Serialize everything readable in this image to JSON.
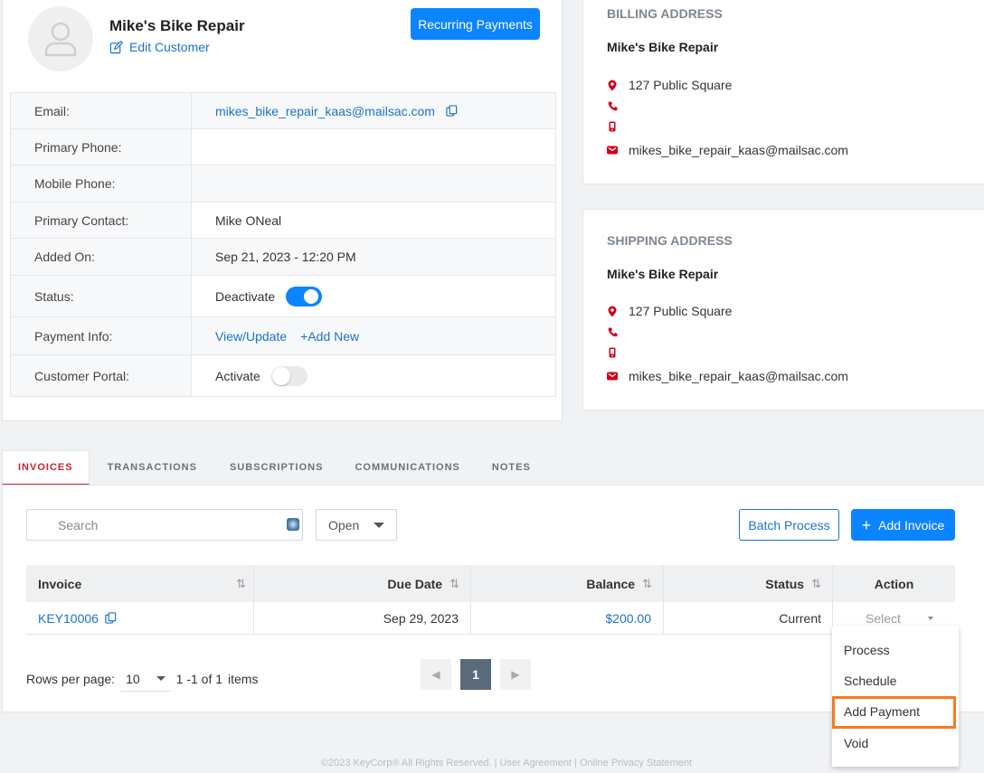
{
  "customer": {
    "name": "Mike's Bike Repair",
    "edit_label": "Edit Customer",
    "recurring_label": "Recurring Payments",
    "fields": {
      "email_label": "Email:",
      "email_value": "mikes_bike_repair_kaas@mailsac.com",
      "primary_phone_label": "Primary Phone:",
      "primary_phone_value": "",
      "mobile_phone_label": "Mobile Phone:",
      "mobile_phone_value": "",
      "primary_contact_label": "Primary Contact:",
      "primary_contact_value": "Mike ONeal",
      "added_on_label": "Added On:",
      "added_on_value": "Sep 21, 2023 - 12:20 PM",
      "status_label": "Status:",
      "status_action": "Deactivate",
      "status_on": true,
      "payment_info_label": "Payment Info:",
      "view_update": "View/Update",
      "add_new": "+Add New",
      "portal_label": "Customer Portal:",
      "portal_action": "Activate",
      "portal_on": false
    }
  },
  "billing": {
    "title": "BILLING ADDRESS",
    "name": "Mike's Bike Repair",
    "street": "127 Public Square",
    "phone": "",
    "mobile": "",
    "email": "mikes_bike_repair_kaas@mailsac.com"
  },
  "shipping": {
    "title": "SHIPPING ADDRESS",
    "name": "Mike's Bike Repair",
    "street": "127 Public Square",
    "phone": "",
    "mobile": "",
    "email": "mikes_bike_repair_kaas@mailsac.com"
  },
  "tabs": [
    "INVOICES",
    "TRANSACTIONS",
    "SUBSCRIPTIONS",
    "COMMUNICATIONS",
    "NOTES"
  ],
  "invoices": {
    "search_placeholder": "Search",
    "filter_value": "Open",
    "batch_label": "Batch Process",
    "add_label": "Add Invoice",
    "columns": [
      "Invoice",
      "Due Date",
      "Balance",
      "Status",
      "Action"
    ],
    "rows": [
      {
        "invoice": "KEY10006",
        "due": "Sep 29, 2023",
        "balance": "$200.00",
        "status": "Current",
        "action": "Select"
      }
    ],
    "rows_per_page_label": "Rows per page:",
    "rows_per_page": "10",
    "range": "1 -1 of 1",
    "items_label": "items",
    "page": "1"
  },
  "menu": [
    "Process",
    "Schedule",
    "Add Payment",
    "Void"
  ],
  "colors": {
    "accent": "#0b84ff",
    "active_tab": "#c82333",
    "highlight": "#f47b20",
    "address_icon": "#d0021b"
  },
  "footer": "©2023 KeyCorp® All Rights Reserved. | User Agreement | Online Privacy Statement"
}
